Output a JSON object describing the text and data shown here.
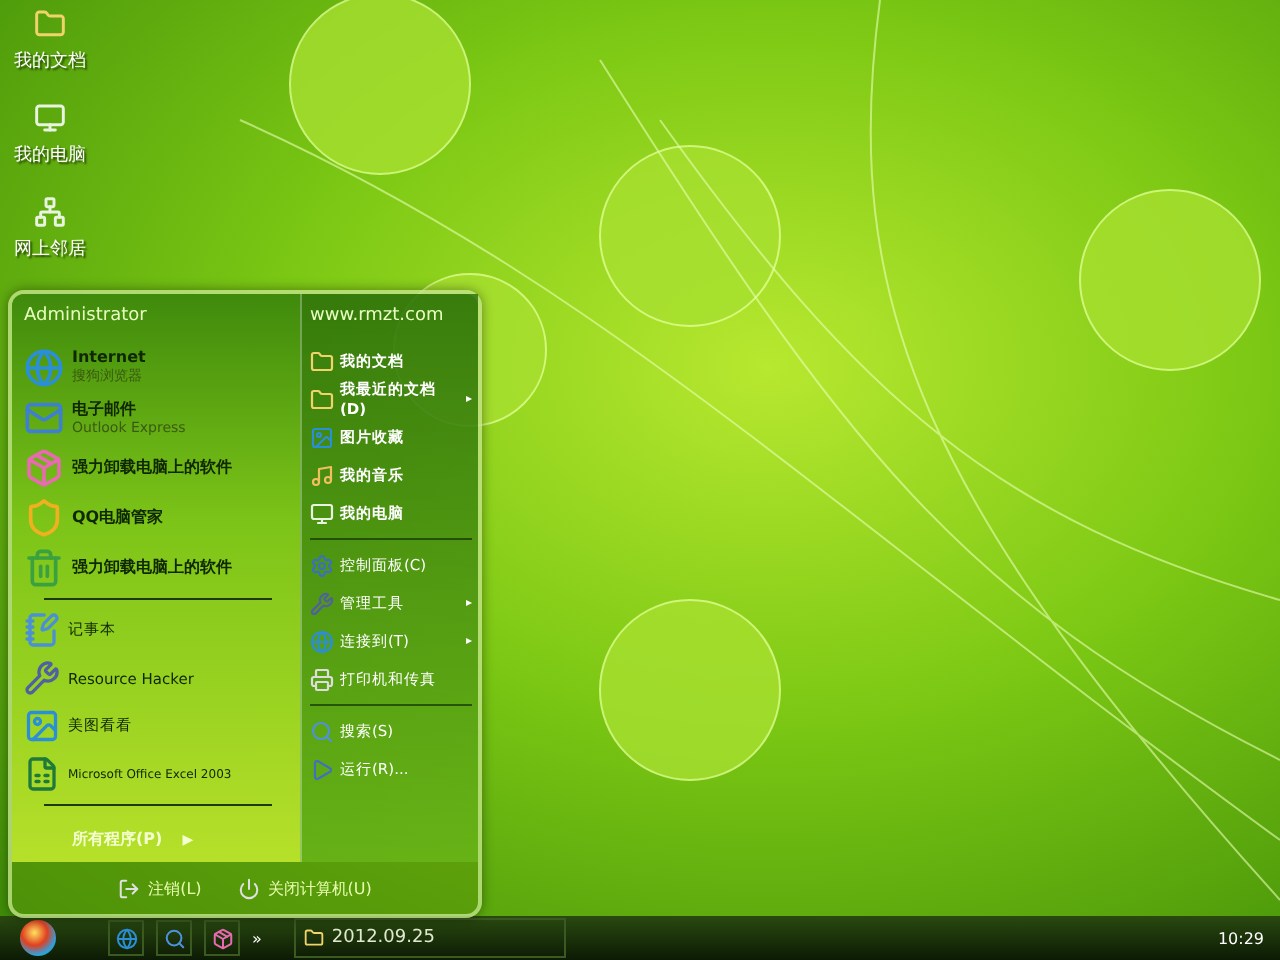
{
  "desktop_icons": [
    {
      "label": "我的文档"
    },
    {
      "label": "我的电脑"
    },
    {
      "label": "网上邻居"
    }
  ],
  "start_menu": {
    "user": "Administrator",
    "website": "www.rmzt.com",
    "pinned": [
      {
        "title": "Internet",
        "subtitle": "搜狗浏览器"
      },
      {
        "title": "电子邮件",
        "subtitle": "Outlook Express"
      },
      {
        "title": "强力卸载电脑上的软件"
      },
      {
        "title": "QQ电脑管家"
      },
      {
        "title": "强力卸载电脑上的软件"
      }
    ],
    "recent": [
      {
        "title": "记事本"
      },
      {
        "title": "Resource Hacker"
      },
      {
        "title": "美图看看"
      },
      {
        "title": "Microsoft Office Excel 2003"
      }
    ],
    "all_programs": {
      "label": "所有程序(P)",
      "arrow": "▶"
    },
    "places": [
      [
        {
          "label": "我的文档"
        },
        {
          "label": "我最近的文档(D)",
          "arrow": "▸"
        },
        {
          "label": "图片收藏"
        },
        {
          "label": "我的音乐"
        },
        {
          "label": "我的电脑"
        }
      ],
      [
        {
          "label": "控制面板(C)"
        },
        {
          "label": "管理工具",
          "arrow": "▸"
        },
        {
          "label": "连接到(T)",
          "arrow": "▸"
        },
        {
          "label": "打印机和传真"
        }
      ],
      [
        {
          "label": "搜索(S)"
        },
        {
          "label": "运行(R)..."
        }
      ]
    ],
    "footer": [
      {
        "label": "注销(L)"
      },
      {
        "label": "关闭计算机(U)"
      }
    ]
  },
  "taskbar": {
    "overflow": "»",
    "tasks": [
      {
        "label": "2012.09.25",
        "selected": false
      }
    ],
    "clock": "10:29"
  }
}
